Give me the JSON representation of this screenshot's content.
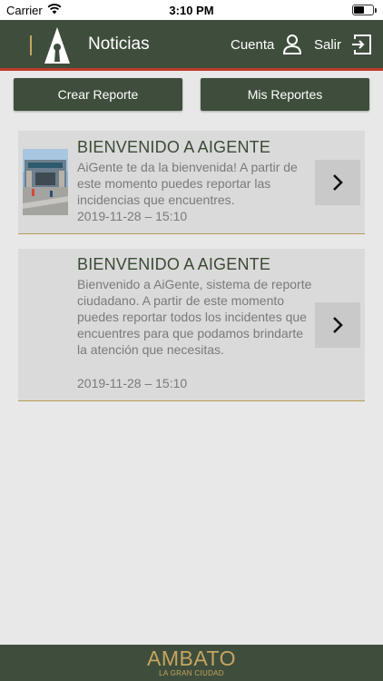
{
  "status_bar": {
    "carrier": "Carrier",
    "time": "3:10 PM",
    "icons": [
      "wifi-icon",
      "battery-icon"
    ]
  },
  "header": {
    "title": "Noticias",
    "account_label": "Cuenta",
    "logout_label": "Salir",
    "icons": [
      "app-logo-icon",
      "user-icon",
      "exit-icon"
    ],
    "accent_color": "#c0392b",
    "background_color": "#3f4e3c"
  },
  "actions": {
    "create_report": "Crear Reporte",
    "my_reports": "Mis Reportes"
  },
  "news": [
    {
      "title": "BIENVENIDO A AIGENTE",
      "body": "AiGente te da la bienvenida! A partir de este momento puedes reportar las incidencias que encuentres.",
      "date": "2019-11-28 – 15:10",
      "has_image": true
    },
    {
      "title": "BIENVENIDO A AIGENTE",
      "body": "Bienvenido a AiGente, sistema de reporte ciudadano. A partir de este momento puedes reportar todos los incidentes que encuentres para que podamos brindarte la atención que necesitas.",
      "date": "2019-11-28 – 15:10",
      "has_image": false
    }
  ],
  "footer": {
    "brand": "AMBATO",
    "tagline": "LA GRAN CIUDAD",
    "brand_color": "#c5a560"
  }
}
